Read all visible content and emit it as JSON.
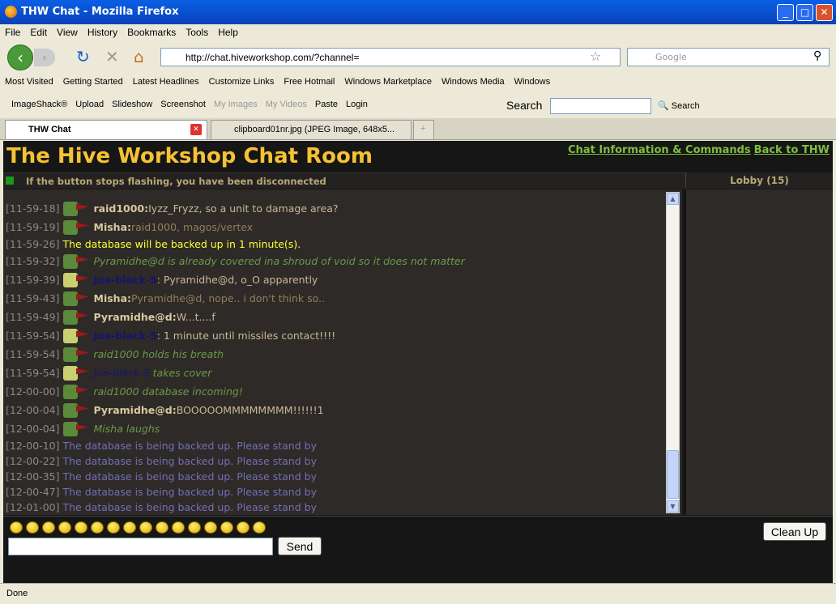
{
  "window": {
    "title": "THW Chat - Mozilla Firefox"
  },
  "menu": [
    "File",
    "Edit",
    "View",
    "History",
    "Bookmarks",
    "Tools",
    "Help"
  ],
  "nav": {
    "url": "http://chat.hiveworkshop.com/?channel=",
    "search_placeholder": "Google"
  },
  "bookmarks": [
    "Most Visited",
    "Getting Started",
    "Latest Headlines",
    "Customize Links",
    "Free Hotmail",
    "Windows Marketplace",
    "Windows Media",
    "Windows"
  ],
  "imageshack": {
    "items": [
      "ImageShack®",
      "Upload",
      "Slideshow",
      "Screenshot",
      "My Images",
      "My Videos",
      "Paste",
      "Login"
    ],
    "search_label": "Search",
    "search_button": "Search"
  },
  "tabs": [
    {
      "label": "THW Chat"
    },
    {
      "label": "clipboard01nr.jpg (JPEG Image, 648x5..."
    }
  ],
  "site": {
    "title": "The Hive Workshop Chat Room",
    "links": [
      "Chat Information & Commands",
      "Back to THW"
    ],
    "status": "If the button stops flashing, you have been disconnected",
    "lobby": "Lobby (15)"
  },
  "messages": [
    {
      "ts": "[11-59-18]",
      "type": "msg",
      "name": "raid1000:",
      "text": " Iyzz_Fryzz, so a unit to damage area?"
    },
    {
      "ts": "[11-59-19]",
      "type": "msg",
      "name": "Misha:",
      "text": " raid1000, magos/vertex",
      "dim": true
    },
    {
      "ts": "[11-59-26]",
      "type": "sys",
      "text": "The database will be backed up in 1 minute(s)."
    },
    {
      "ts": "[11-59-32]",
      "type": "act",
      "text": "Pyramidhe@d is already covered ina shroud of void so it does not matter"
    },
    {
      "ts": "[11-59-39]",
      "type": "msg",
      "name": "Joe-black-5",
      "joe": true,
      "text": ": Pyramidhe@d, o_O apparently"
    },
    {
      "ts": "[11-59-43]",
      "type": "msg",
      "name": "Misha:",
      "text": " Pyramidhe@d, nope.. i don't think so..",
      "dim": true
    },
    {
      "ts": "[11-59-49]",
      "type": "msg",
      "name": "Pyramidhe@d:",
      "text": " W...t....f"
    },
    {
      "ts": "[11-59-54]",
      "type": "msg",
      "name": "Joe-black-5",
      "joe": true,
      "text": ": 1 minute until missiles contact!!!!"
    },
    {
      "ts": "[11-59-54]",
      "type": "act",
      "text": "raid1000 holds his breath"
    },
    {
      "ts": "[11-59-54]",
      "type": "act",
      "joe": true,
      "name": "Joe-black-5",
      "text": " takes cover"
    },
    {
      "ts": "[12-00-00]",
      "type": "act",
      "text": "raid1000 database incoming!"
    },
    {
      "ts": "[12-00-04]",
      "type": "msg",
      "name": "Pyramidhe@d:",
      "text": " BOOOOOMMMMMMMM!!!!!!1"
    },
    {
      "ts": "[12-00-04]",
      "type": "act",
      "text": "Misha laughs"
    },
    {
      "ts": "[12-00-10]",
      "type": "backup",
      "text": "The database is being backed up. Please stand by"
    },
    {
      "ts": "[12-00-22]",
      "type": "backup",
      "text": "The database is being backed up. Please stand by"
    },
    {
      "ts": "[12-00-35]",
      "type": "backup",
      "text": "The database is being backed up. Please stand by"
    },
    {
      "ts": "[12-00-47]",
      "type": "backup",
      "text": "The database is being backed up. Please stand by"
    },
    {
      "ts": "[12-01-00]",
      "type": "backup",
      "text": "The database is being backed up. Please stand by"
    }
  ],
  "input": {
    "send": "Send",
    "cleanup": "Clean Up"
  },
  "statusbar": "Done",
  "colors": {
    "title": "#f5c233",
    "links": "#7fbf3f",
    "system": "#ffff33",
    "backup": "#7070b8",
    "action": "#6a9a4a"
  }
}
